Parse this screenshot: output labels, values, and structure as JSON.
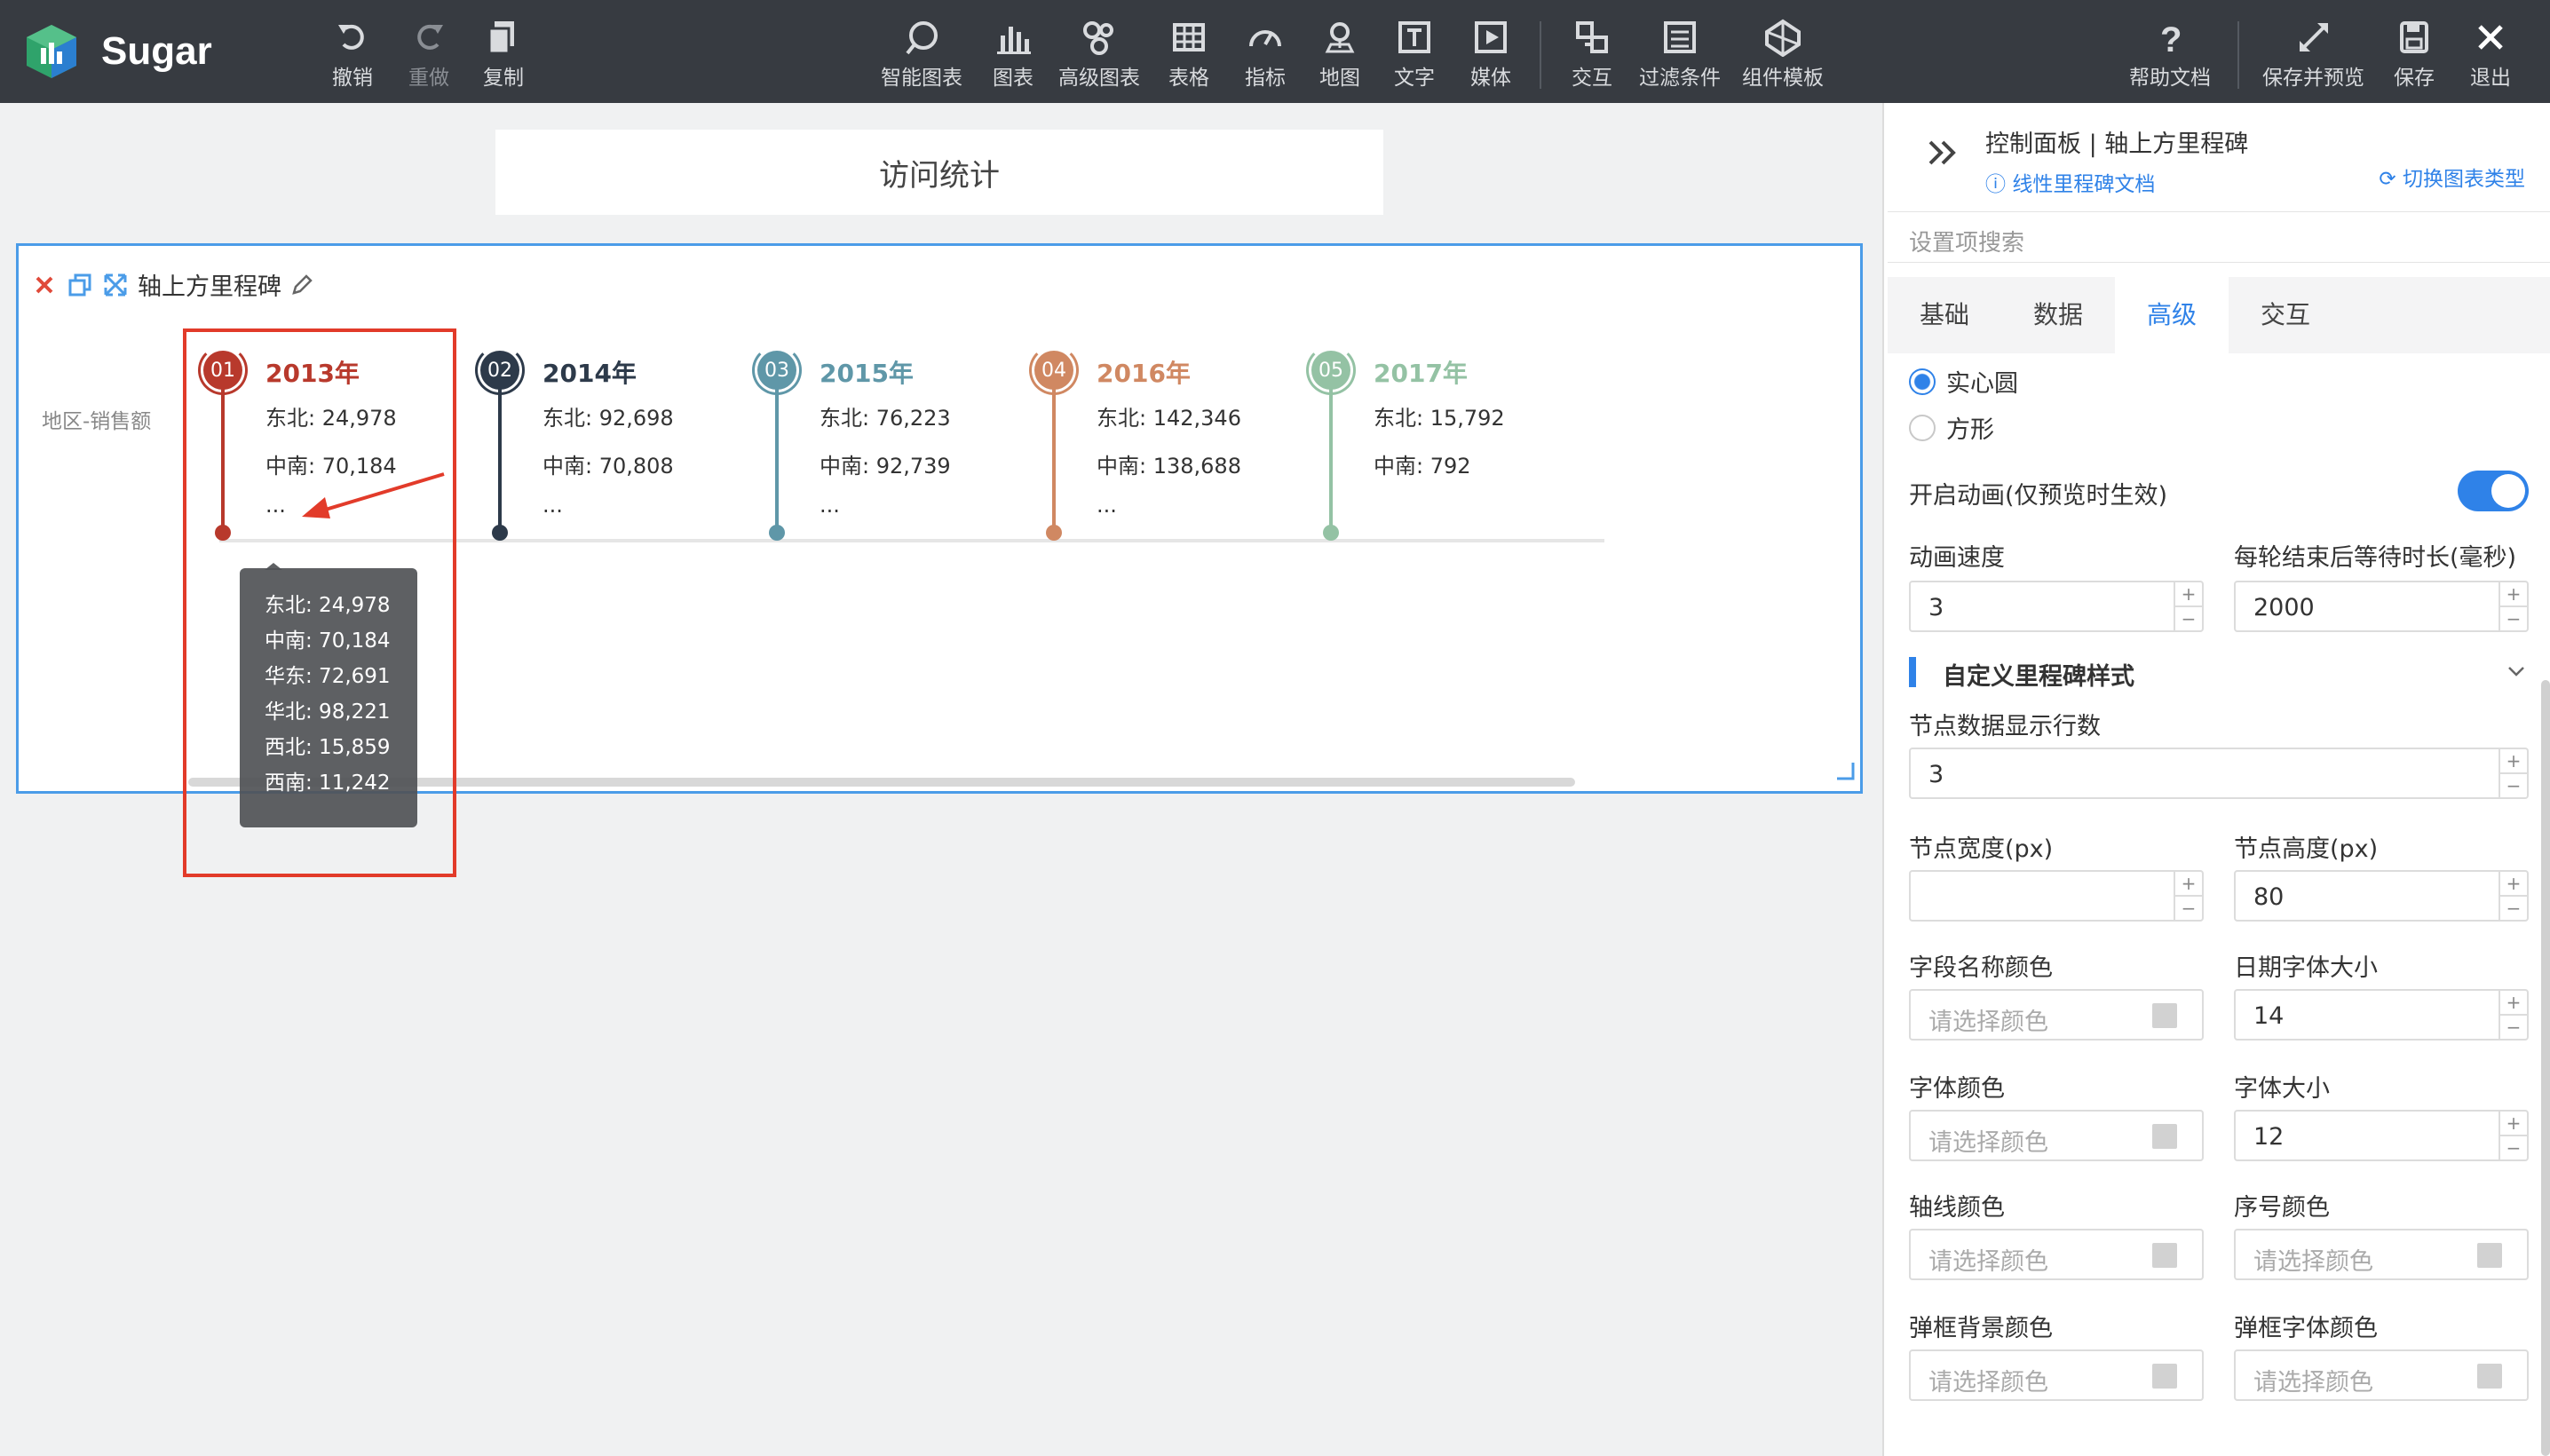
{
  "app": {
    "name": "Sugar"
  },
  "toolbar": {
    "undo": "撤销",
    "redo": "重做",
    "copy": "复制",
    "smart_chart": "智能图表",
    "chart": "图表",
    "advanced_chart": "高级图表",
    "table": "表格",
    "indicator": "指标",
    "map": "地图",
    "text": "文字",
    "media": "媒体",
    "interaction": "交互",
    "filter": "过滤条件",
    "component_template": "组件模板",
    "help": "帮助文档",
    "save_preview": "保存并预览",
    "save": "保存",
    "exit": "退出"
  },
  "canvas": {
    "title": "访问统计",
    "widget_title": "轴上方里程碑",
    "row_label": "地区-销售额",
    "ellipsis": "..."
  },
  "milestones": [
    {
      "index": "01",
      "year": "2013年",
      "line1": "东北: 24,978",
      "line2": "中南: 70,184",
      "more": "...",
      "color": "#b8392c"
    },
    {
      "index": "02",
      "year": "2014年",
      "line1": "东北: 92,698",
      "line2": "中南: 70,808",
      "more": "...",
      "color": "#2d3a4a"
    },
    {
      "index": "03",
      "year": "2015年",
      "line1": "东北: 76,223",
      "line2": "中南: 92,739",
      "more": "...",
      "color": "#5f97a8"
    },
    {
      "index": "04",
      "year": "2016年",
      "line1": "东北: 142,346",
      "line2": "中南: 138,688",
      "more": "...",
      "color": "#d08862"
    },
    {
      "index": "05",
      "year": "2017年",
      "line1": "东北: 15,792",
      "line2": "中南: 792",
      "more": "",
      "color": "#94c2a4"
    }
  ],
  "tooltip": [
    "东北: 24,978",
    "中南: 70,184",
    "华东: 72,691",
    "华北: 98,221",
    "西北: 15,859",
    "西南: 11,242"
  ],
  "panel": {
    "title": "控制面板 | 轴上方里程碑",
    "doc_link": "线性里程碑文档",
    "switch_type": "切换图表类型",
    "search_placeholder": "设置项搜索",
    "tabs": [
      "基础",
      "数据",
      "高级",
      "交互"
    ],
    "active_tab": "高级",
    "shape_solid": "实心圆",
    "shape_square": "方形",
    "animation_label": "开启动画(仅预览时生效)",
    "animation_on": true,
    "speed_label": "动画速度",
    "speed_value": "3",
    "wait_label": "每轮结束后等待时长(毫秒)",
    "wait_value": "2000",
    "section_title": "自定义里程碑样式",
    "rows_label": "节点数据显示行数",
    "rows_value": "3",
    "node_width_label": "节点宽度(px)",
    "node_width_value": "",
    "node_height_label": "节点高度(px)",
    "node_height_value": "80",
    "field_color_label": "字段名称颜色",
    "date_font_label": "日期字体大小",
    "date_font_value": "14",
    "font_color_label": "字体颜色",
    "font_size_label": "字体大小",
    "font_size_value": "12",
    "axis_color_label": "轴线颜色",
    "seq_color_label": "序号颜色",
    "popup_bg_label": "弹框背景颜色",
    "popup_font_label": "弹框字体颜色",
    "color_placeholder": "请选择颜色"
  }
}
